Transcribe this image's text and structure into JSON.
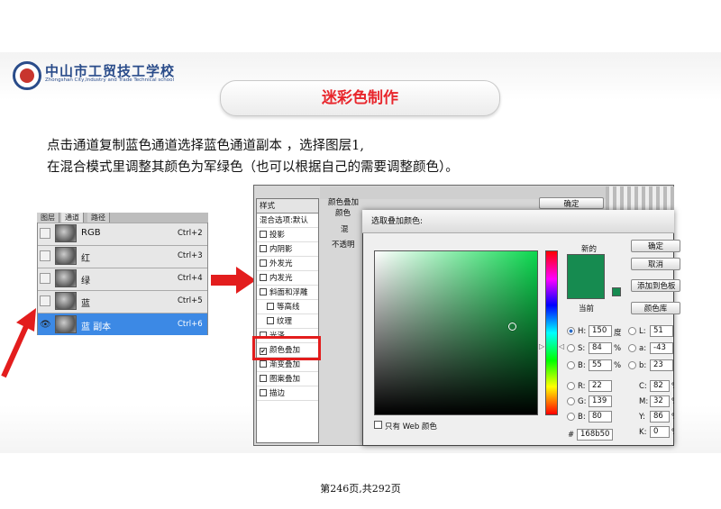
{
  "school": {
    "name_cn": "中山市工贸技工学校",
    "name_en": "Zhongshan City,Industry and Trade Technical school"
  },
  "slide_title": "迷彩色制作",
  "description": [
    "点击通道复制蓝色通道选择蓝色通道副本 ，选择图层1,",
    "在混合模式里调整其颜色为军绿色（也可以根据自己的需要调整颜色）。"
  ],
  "channels_panel": {
    "tabs": [
      "图层",
      "通道",
      "路径"
    ],
    "rows": [
      {
        "name": "RGB",
        "shortcut": "Ctrl+2",
        "selected": false
      },
      {
        "name": "红",
        "shortcut": "Ctrl+3",
        "selected": false
      },
      {
        "name": "绿",
        "shortcut": "Ctrl+4",
        "selected": false
      },
      {
        "name": "蓝",
        "shortcut": "Ctrl+5",
        "selected": false
      },
      {
        "name": "蓝 副本",
        "shortcut": "Ctrl+6",
        "selected": true
      }
    ]
  },
  "layer_style": {
    "header": "样式",
    "items": [
      "混合选项:默认",
      "投影",
      "内阴影",
      "外发光",
      "内发光",
      "斜面和浮雕",
      "等高线",
      "纹理",
      "光泽",
      "颜色叠加",
      "渐变叠加",
      "图案叠加",
      "描边"
    ],
    "checked_item": "颜色叠加",
    "section_title": "颜色叠加",
    "section_sub": "颜色",
    "blend_label": "混",
    "opacity_label": "不透明",
    "ok_button": "确定"
  },
  "color_picker": {
    "title": "选取叠加颜色:",
    "new_label": "新的",
    "current_label": "当前",
    "ok": "确定",
    "cancel": "取消",
    "add_swatch": "添加到色板",
    "libraries": "颜色库",
    "web_only": "只有 Web 颜色",
    "hsb": [
      {
        "label": "H:",
        "value": "150",
        "unit": "度"
      },
      {
        "label": "S:",
        "value": "84",
        "unit": "%"
      },
      {
        "label": "B:",
        "value": "55",
        "unit": "%"
      }
    ],
    "lab": [
      {
        "label": "L:",
        "value": "51"
      },
      {
        "label": "a:",
        "value": "-43"
      },
      {
        "label": "b:",
        "value": "23"
      }
    ],
    "rgb": [
      {
        "label": "R:",
        "value": "22"
      },
      {
        "label": "G:",
        "value": "139"
      },
      {
        "label": "B:",
        "value": "80"
      }
    ],
    "cmyk": [
      {
        "label": "C:",
        "value": "82",
        "unit": "%"
      },
      {
        "label": "M:",
        "value": "32",
        "unit": "%"
      },
      {
        "label": "Y:",
        "value": "86",
        "unit": "%"
      },
      {
        "label": "K:",
        "value": "0",
        "unit": "%"
      }
    ],
    "hex_label": "#",
    "hex": "168b50",
    "new_color": "#168b50",
    "current_color": "#168b50"
  },
  "footer": "第246页,共292页"
}
